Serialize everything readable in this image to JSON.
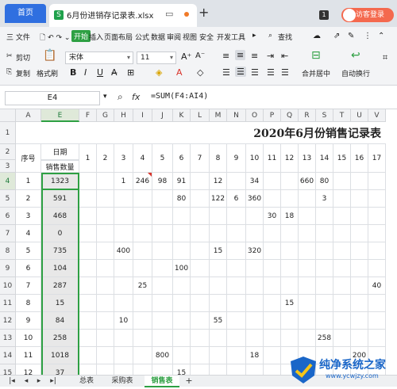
{
  "tabs": {
    "home": "首页",
    "document": "6月份进销存记录表.xlsx",
    "login": "访客登录",
    "badge": "1"
  },
  "menu": {
    "file": "三 文件",
    "items": [
      "开始",
      "插入",
      "页面布局",
      "公式",
      "数据",
      "审阅",
      "视图",
      "安全",
      "开发工具"
    ],
    "active": "开始",
    "search": "查找"
  },
  "ribbon": {
    "cut": "剪切",
    "copy": "复制",
    "format_painter": "格式刷",
    "paste": "粘贴",
    "font": "宋体",
    "size": "11",
    "merge": "合并居中",
    "wrap": "自动换行"
  },
  "formula_bar": {
    "cell_ref": "E4",
    "fx": "fx",
    "formula": "=SUM(F4:AI4)"
  },
  "sheet": {
    "columns": [
      "A",
      "E",
      "F",
      "G",
      "H",
      "I",
      "J",
      "K",
      "L",
      "M",
      "N",
      "O",
      "P",
      "Q",
      "R",
      "S",
      "T",
      "U",
      "V"
    ],
    "title": "2020年6月份销售记录表",
    "header_row2": [
      "序号",
      "日期",
      "1",
      "2",
      "3",
      "4",
      "5",
      "6",
      "7",
      "8",
      "9",
      "10",
      "11",
      "12",
      "13",
      "14",
      "15",
      "16",
      "17"
    ],
    "header_row3_E": "销售数量",
    "row_numbers": [
      "1",
      "2",
      "3",
      "4",
      "5",
      "6",
      "7",
      "8",
      "9",
      "10",
      "11",
      "12",
      "13",
      "14",
      "15"
    ],
    "data_rows": [
      [
        "1",
        "1323",
        "",
        "",
        "1",
        "246",
        "98",
        "91",
        "",
        "12",
        "",
        "34",
        "",
        "",
        "660",
        "80",
        "",
        "",
        ""
      ],
      [
        "2",
        "591",
        "",
        "",
        "",
        "",
        "",
        "80",
        "",
        "122",
        "6",
        "360",
        "",
        "",
        "",
        "3",
        "",
        "",
        ""
      ],
      [
        "3",
        "468",
        "",
        "",
        "",
        "",
        "",
        "",
        "",
        "",
        "",
        "",
        "30",
        "18",
        "",
        "",
        "",
        "",
        ""
      ],
      [
        "4",
        "0",
        "",
        "",
        "",
        "",
        "",
        "",
        "",
        "",
        "",
        "",
        "",
        "",
        "",
        "",
        "",
        "",
        ""
      ],
      [
        "5",
        "735",
        "",
        "",
        "400",
        "",
        "",
        "",
        "",
        "15",
        "",
        "320",
        "",
        "",
        "",
        "",
        "",
        "",
        ""
      ],
      [
        "6",
        "104",
        "",
        "",
        "",
        "",
        "",
        "100",
        "",
        "",
        "",
        "",
        "",
        "",
        "",
        "",
        "",
        "",
        ""
      ],
      [
        "7",
        "287",
        "",
        "",
        "",
        "25",
        "",
        "",
        "",
        "",
        "",
        "",
        "",
        "",
        "",
        "",
        "",
        "",
        "40"
      ],
      [
        "8",
        "15",
        "",
        "",
        "",
        "",
        "",
        "",
        "",
        "",
        "",
        "",
        "",
        "15",
        "",
        "",
        "",
        "",
        ""
      ],
      [
        "9",
        "84",
        "",
        "",
        "10",
        "",
        "",
        "",
        "",
        "55",
        "",
        "",
        "",
        "",
        "",
        "",
        "",
        "",
        ""
      ],
      [
        "10",
        "258",
        "",
        "",
        "",
        "",
        "",
        "",
        "",
        "",
        "",
        "",
        "",
        "",
        "",
        "258",
        "",
        "",
        ""
      ],
      [
        "11",
        "1018",
        "",
        "",
        "",
        "",
        "800",
        "",
        "",
        "",
        "",
        "18",
        "",
        "",
        "",
        "",
        "",
        "200",
        ""
      ],
      [
        "12",
        "37",
        "",
        "",
        "",
        "",
        "",
        "15",
        "",
        "",
        "",
        "",
        "",
        "",
        "",
        "",
        "",
        "",
        ""
      ]
    ]
  },
  "sheet_tabs": [
    "总表",
    "采购表",
    "销售表"
  ],
  "active_sheet": "销售表",
  "watermark": {
    "text": "纯净系统之家",
    "url": "www.ycwjzy.com"
  },
  "colors": {
    "accent": "#2ea043",
    "tab_blue": "#2f6fe0",
    "login": "#f4694e"
  }
}
